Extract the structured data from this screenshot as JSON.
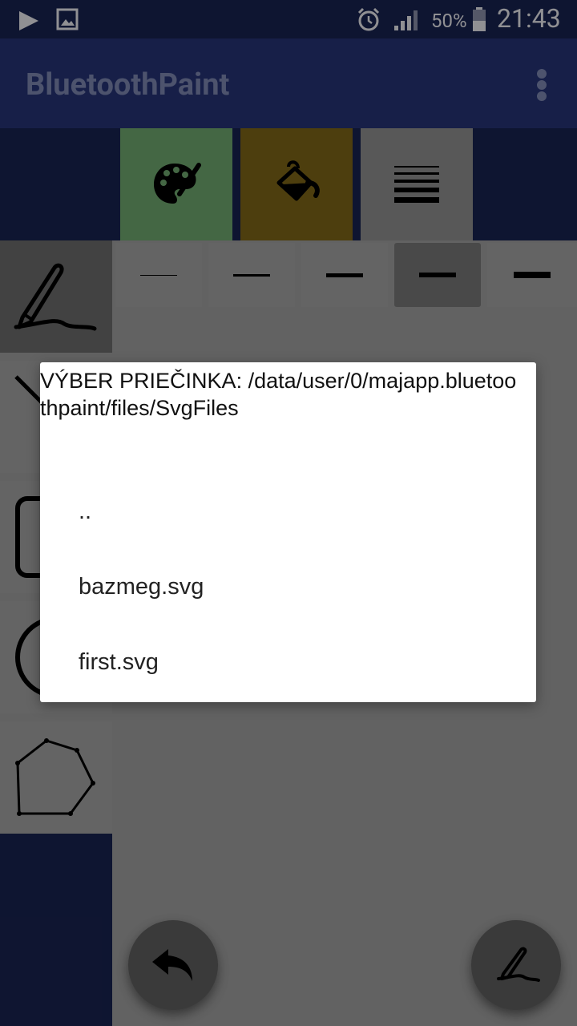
{
  "status_bar": {
    "battery": "50%",
    "time": "21:43"
  },
  "app_bar": {
    "title": "BluetoothPaint"
  },
  "toolbar": {
    "colors": {
      "palette_bg": "#6fa66f",
      "fill_bg": "#7d6418",
      "stroke_bg": "#8f8f8f"
    }
  },
  "stroke_widths": {
    "selected_index": 3
  },
  "dialog": {
    "title": "VÝBER PRIEČINKA: /data/user/0/majapp.bluetoothpaint/files/SvgFiles",
    "items": [
      {
        "label": ".."
      },
      {
        "label": "bazmeg.svg"
      },
      {
        "label": "first.svg"
      }
    ]
  },
  "colors": {
    "status_bar": "#18224f",
    "app_bar": "#263375",
    "scrim": "rgba(0,0,0,0.38)"
  }
}
